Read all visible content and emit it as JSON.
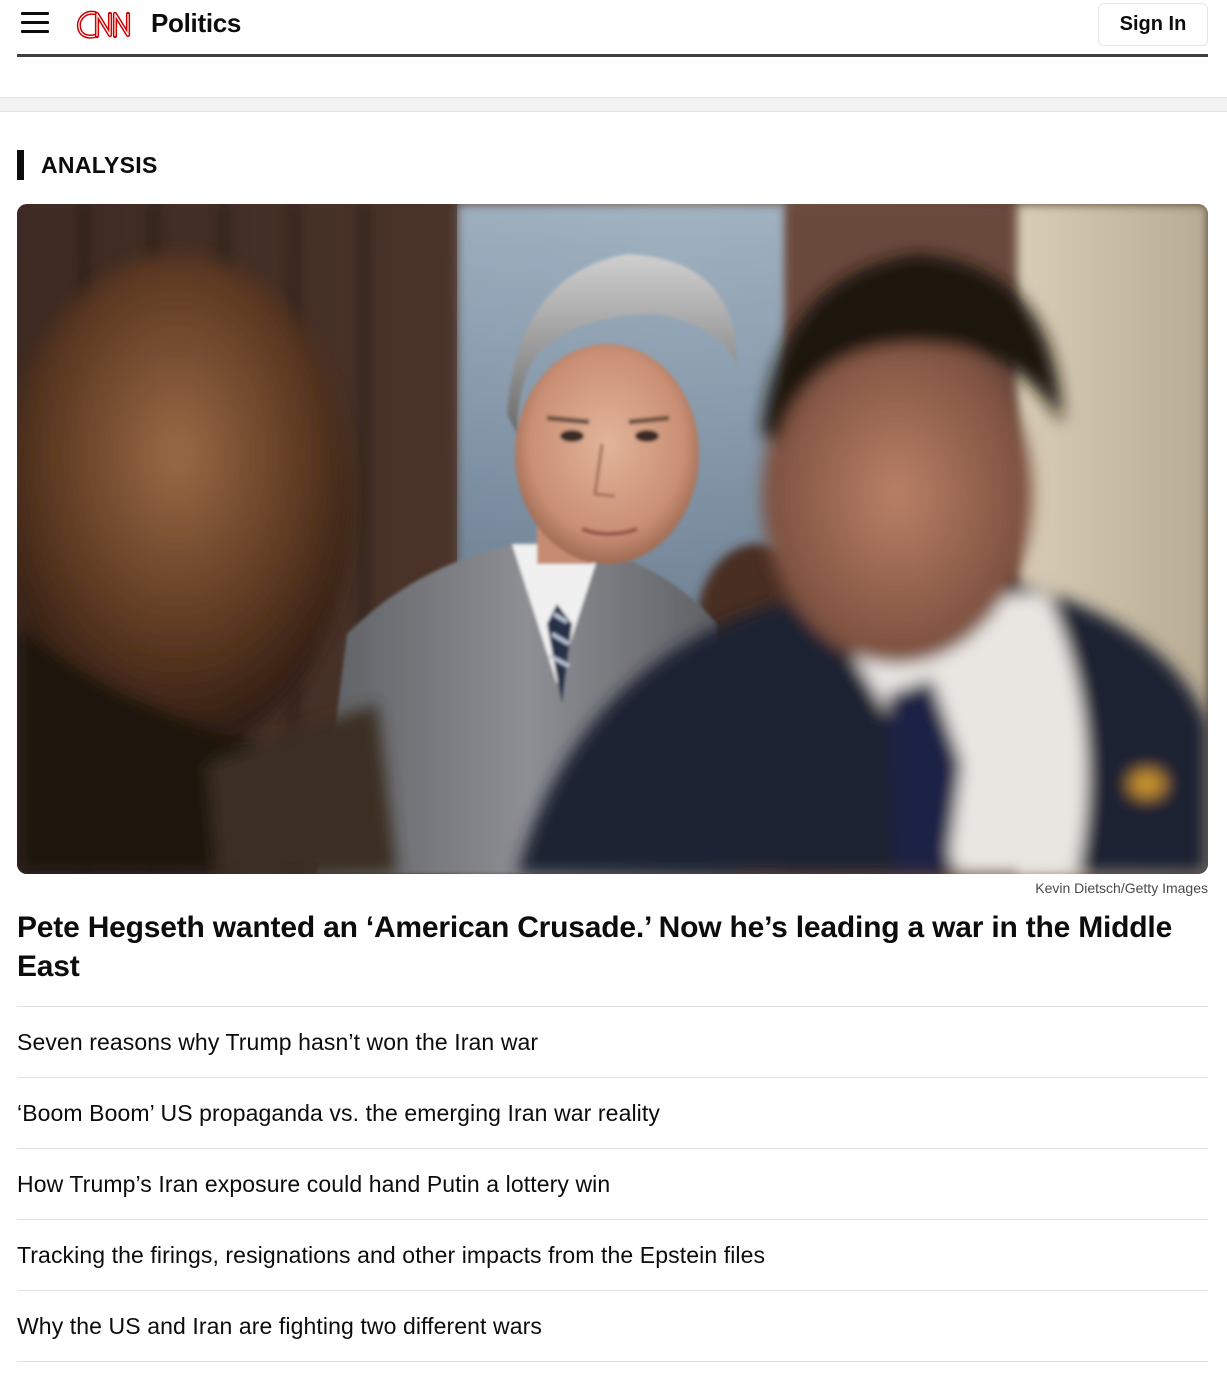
{
  "header": {
    "brand": "CNN",
    "section": "Politics",
    "signin_label": "Sign In",
    "menu_icon": "hamburger-menu-icon",
    "brand_color": "#cc0000"
  },
  "article": {
    "label": "ANALYSIS",
    "image_alt": "Photo: man in grey suit walking past a blurred man in dark suit",
    "credit": "Kevin Dietsch/Getty Images",
    "headline": "Pete Hegseth wanted an ‘American Crusade.’ Now he’s leading a war in the Middle East"
  },
  "related": [
    {
      "title": "Seven reasons why Trump hasn’t won the Iran war"
    },
    {
      "title": "‘Boom Boom’ US propaganda vs. the emerging Iran war reality"
    },
    {
      "title": "How Trump’s Iran exposure could hand Putin a lottery win"
    },
    {
      "title": "Tracking the firings, resignations and other impacts from the Epstein files"
    },
    {
      "title": "Why the US and Iran are fighting two different wars"
    }
  ]
}
